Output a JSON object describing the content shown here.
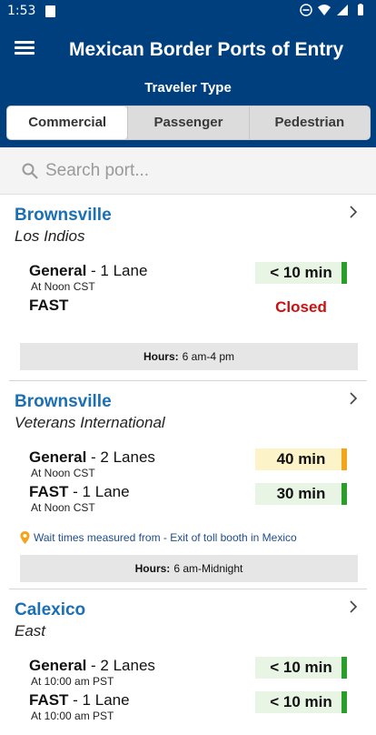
{
  "status_bar": {
    "time": "1:53"
  },
  "header": {
    "title": "Mexican Border Ports of Entry",
    "traveler_label": "Traveler Type",
    "tabs": [
      {
        "label": "Commercial",
        "active": true
      },
      {
        "label": "Passenger",
        "active": false
      },
      {
        "label": "Pedestrian",
        "active": false
      }
    ]
  },
  "search": {
    "placeholder": "Search port..."
  },
  "ports": [
    {
      "city": "Brownsville",
      "crossing": "Los Indios",
      "lanes": [
        {
          "type": "General",
          "lanes": " - 1 Lane",
          "measured": "At Noon CST",
          "wait": "< 10 min",
          "status_color": "#2a9d2a",
          "bg": "#e8f5e4"
        },
        {
          "type": "FAST",
          "lanes": "",
          "measured": "",
          "wait": "Closed",
          "status_color": "",
          "bg": ""
        }
      ],
      "note": "",
      "hours_label": "Hours:",
      "hours_value": "6 am-4 pm"
    },
    {
      "city": "Brownsville",
      "crossing": "Veterans International",
      "lanes": [
        {
          "type": "General",
          "lanes": " - 2 Lanes",
          "measured": "At Noon CST",
          "wait": "40 min",
          "status_color": "#f2a51a",
          "bg": "#fdf3c8"
        },
        {
          "type": "FAST",
          "lanes": " - 1 Lane",
          "measured": "At Noon CST",
          "wait": "30 min",
          "status_color": "#2a9d2a",
          "bg": "#e8f5e4"
        }
      ],
      "note": "Wait times measured from - Exit of toll booth in Mexico",
      "hours_label": "Hours:",
      "hours_value": "6 am-Midnight"
    },
    {
      "city": "Calexico",
      "crossing": "East",
      "lanes": [
        {
          "type": "General",
          "lanes": " - 2 Lanes",
          "measured": "At 10:00 am PST",
          "wait": "< 10 min",
          "status_color": "#2a9d2a",
          "bg": "#e8f5e4"
        },
        {
          "type": "FAST",
          "lanes": " - 1 Lane",
          "measured": "At 10:00 am PST",
          "wait": "< 10 min",
          "status_color": "#2a9d2a",
          "bg": "#e8f5e4"
        }
      ],
      "note": "",
      "hours_label": "",
      "hours_value": ""
    }
  ],
  "colors": {
    "header_bg": "#003f7d",
    "link_blue": "#1a6fb5",
    "closed_red": "#cc1010"
  }
}
